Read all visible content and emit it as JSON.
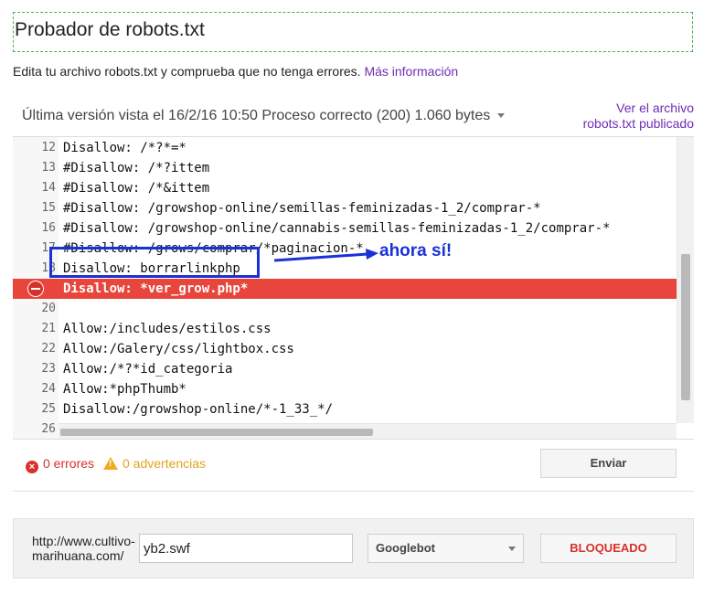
{
  "header": {
    "title": "Probador de robots.txt",
    "subtitle": "Edita tu archivo robots.txt y comprueba que no tenga errores. ",
    "more_info_link": "Más información"
  },
  "version_bar": {
    "last_version": "Última versión vista el 16/2/16 10:50 Proceso correcto (200) 1.060 bytes",
    "view_file_line1": "Ver el archivo",
    "view_file_line2": "robots.txt publicado"
  },
  "editor": {
    "lines": [
      {
        "num": "12",
        "code": "Disallow: /*?*=*",
        "error": false
      },
      {
        "num": "13",
        "code": "#Disallow: /*?ittem",
        "error": false
      },
      {
        "num": "14",
        "code": "#Disallow: /*&ittem",
        "error": false
      },
      {
        "num": "15",
        "code": "#Disallow: /growshop-online/semillas-feminizadas-1_2/comprar-*",
        "error": false
      },
      {
        "num": "16",
        "code": "#Disallow: /growshop-online/cannabis-semillas-feminizadas-1_2/comprar-*",
        "error": false
      },
      {
        "num": "17",
        "code": "#Disallow: /grows/comprar/*paginacion-*",
        "error": false
      },
      {
        "num": "18",
        "code": "Disallow: borrarlinkphp",
        "error": false
      },
      {
        "num": "19",
        "code": "Disallow: *ver_grow.php*",
        "error": true
      },
      {
        "num": "20",
        "code": "",
        "error": false
      },
      {
        "num": "21",
        "code": "Allow:/includes/estilos.css",
        "error": false
      },
      {
        "num": "22",
        "code": "Allow:/Galery/css/lightbox.css",
        "error": false
      },
      {
        "num": "23",
        "code": "Allow:/*?*id_categoria",
        "error": false
      },
      {
        "num": "24",
        "code": "Allow:*phpThumb*",
        "error": false
      },
      {
        "num": "25",
        "code": "Disallow:/growshop-online/*-1_33_*/",
        "error": false
      },
      {
        "num": "26",
        "code": "",
        "error": false
      }
    ],
    "annotation": "ahora sí!",
    "annotation_color": "#1a31d6"
  },
  "status": {
    "errors": "0 errores",
    "warnings": "0 advertencias",
    "send_button": "Enviar"
  },
  "tester": {
    "url_prefix_line1": "http://www.cultivo-",
    "url_prefix_line2": "marihuana.com/",
    "url_value": "yb2.swf",
    "user_agent": "Googlebot",
    "result": "BLOQUEADO"
  },
  "colors": {
    "error_red": "#e8453c",
    "link_purple": "#6e2db4",
    "warning_orange": "#e0a320"
  }
}
